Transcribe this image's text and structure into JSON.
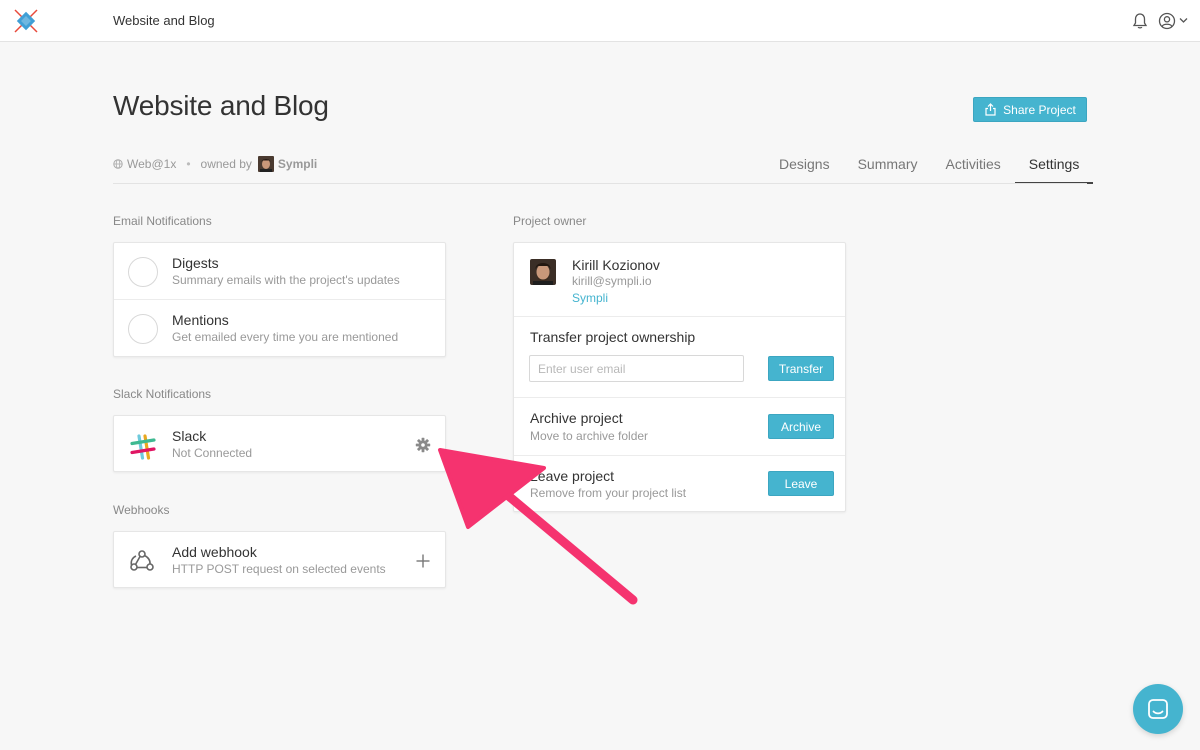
{
  "topbar": {
    "title": "Website and Blog"
  },
  "header": {
    "title": "Website and Blog",
    "share_label": "Share Project",
    "platform": "Web@1x",
    "owned_by_label": "owned by",
    "owner": "Sympli"
  },
  "tabs": [
    {
      "label": "Designs"
    },
    {
      "label": "Summary"
    },
    {
      "label": "Activities"
    },
    {
      "label": "Settings",
      "active": true
    }
  ],
  "email_notifications": {
    "label": "Email Notifications",
    "items": [
      {
        "title": "Digests",
        "subtitle": "Summary emails with the project's updates"
      },
      {
        "title": "Mentions",
        "subtitle": "Get emailed every time you are mentioned"
      }
    ]
  },
  "slack_notifications": {
    "label": "Slack Notifications",
    "title": "Slack",
    "status": "Not Connected"
  },
  "webhooks": {
    "label": "Webhooks",
    "title": "Add webhook",
    "subtitle": "HTTP POST request on selected events"
  },
  "project_owner": {
    "label": "Project owner",
    "name": "Kirill Kozionov",
    "email": "kirill@sympli.io",
    "company": "Sympli",
    "transfer": {
      "title": "Transfer project ownership",
      "placeholder": "Enter user email",
      "button": "Transfer"
    },
    "archive": {
      "title": "Archive project",
      "subtitle": "Move to archive folder",
      "button": "Archive"
    },
    "leave": {
      "title": "Leave project",
      "subtitle": "Remove from your project list",
      "button": "Leave"
    }
  },
  "colors": {
    "accent": "#45b4cf",
    "arrow": "#f5336f",
    "background": "#f7f7f7"
  },
  "icons": [
    "sympli-logo-icon",
    "bell-icon",
    "user-circle-icon",
    "chevron-down-icon",
    "share-icon",
    "globe-icon",
    "slack-icon",
    "gear-icon",
    "webhook-icon",
    "plus-icon",
    "chat-icon"
  ]
}
